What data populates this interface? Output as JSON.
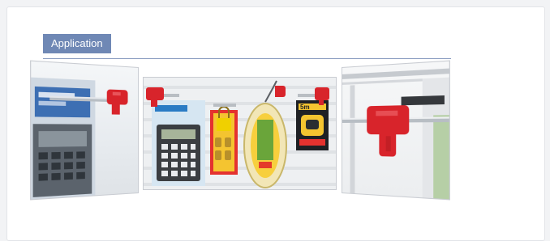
{
  "section": {
    "title": "Application"
  },
  "colors": {
    "title_background": "#6f88b5",
    "rule": "#8a9cc0",
    "stop_lock_red": "#d8242b"
  },
  "images": [
    {
      "name": "hook-lock-on-display-hook",
      "content": "photo"
    },
    {
      "name": "pegboard-products-with-stop-locks",
      "content": "photo",
      "packaging_text": [
        "5m"
      ]
    },
    {
      "name": "stop-lock-closeup",
      "content": "photo"
    }
  ]
}
